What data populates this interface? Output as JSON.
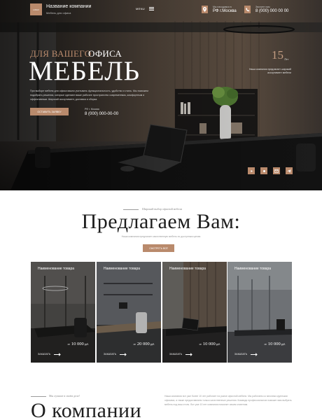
{
  "header": {
    "logo_text": "LOGO",
    "company_name": "Название компании",
    "company_sub": "Мебель для офиса",
    "menu_label": "MENU",
    "city_label": "Мы находимся в",
    "city_value": "РФ г.Москва",
    "phone_label": "Звоните нам",
    "phone_value": "8 (000) 000 00 00"
  },
  "hero": {
    "eyebrow_accent": "ДЛЯ ВАШЕГО",
    "eyebrow_rest": "ОФИСА",
    "title": "МЕБЕЛЬ",
    "description": "При выборе мебели для офиса важно учитывать функциональность, удобство и стиль. Мы поможем подобрать решения, которые сделают ваше рабочее пространство современным, комфортным и эффективным. Широкий ассортимент, доставка и сборка.",
    "button_label": "ОСТАВИТЬ ЗАЯВКУ",
    "phone_label": "РФ г. Москва",
    "phone": "8 (000) 000-00-00",
    "years_number": "15",
    "years_unit": "Лет",
    "years_desc": "Наша компания предлагает широкий ассортимент мебели"
  },
  "social": [
    {
      "icon": "youtube-icon"
    },
    {
      "icon": "vk-icon"
    },
    {
      "icon": "mail-icon"
    },
    {
      "icon": "telegram-icon"
    }
  ],
  "offer": {
    "eyebrow": "Широкий выбор офисной мебели",
    "title": "Предлагаем Вам:",
    "subtitle": "Наша компания предлагает качественную мебель по доступным ценам",
    "button_label": "СМОТРЕТЬ ВСЁ"
  },
  "products": [
    {
      "name": "Наименование товара",
      "price_prefix": "от",
      "price": "10 000",
      "currency": "руб.",
      "order_label": "ЗАКАЗАТЬ"
    },
    {
      "name": "Наименование товара",
      "price_prefix": "от",
      "price": "20 000",
      "currency": "руб.",
      "order_label": "ЗАКАЗАТЬ"
    },
    {
      "name": "Наименование товара",
      "price_prefix": "от",
      "price": "10 000",
      "currency": "руб.",
      "order_label": "ЗАКАЗАТЬ"
    },
    {
      "name": "Наименование товара",
      "price_prefix": "от",
      "price": "10 000",
      "currency": "руб.",
      "order_label": "ЗАКАЗАТЬ"
    }
  ],
  "about": {
    "eyebrow": "Мы лучшие в своём деле!",
    "title": "О компании",
    "text": "Наша компания вот уже более 10 лет работает на рынке офисной мебели. Мы работаем со многими крупными офисами, а также предоставляем только качественные решения. Команда профессионалов поможет вам выбрать мебель под ваш стиль. Вот уже 10 лет компания помогает своим клиентам."
  },
  "colors": {
    "accent": "#b98a6c",
    "dark": "#232323"
  }
}
